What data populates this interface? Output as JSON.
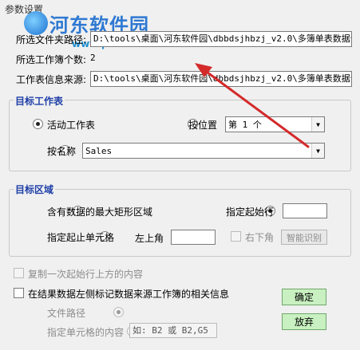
{
  "window": {
    "title": "参数设置"
  },
  "watermark": {
    "brand": "河东软件园",
    "url": "www.pc0359.cn"
  },
  "top": {
    "file_path_label": "所选文件夹路径:",
    "file_path_value": "D:\\tools\\桌面\\河东软件园\\dbbdsjhbzj_v2.0\\多簿单表数据合",
    "workbook_count_label": "所选工作簿个数:",
    "workbook_count_value": "2",
    "sheet_source_label": "工作表信息来源:",
    "sheet_source_value": "D:\\tools\\桌面\\河东软件园\\dbbdsjhbzj_v2.0\\多簿单表数据合"
  },
  "target_sheet": {
    "legend": "目标工作表",
    "active_label": "活动工作表",
    "by_position_label": "按位置",
    "position_value": "第 1 个",
    "by_name_label": "按名称",
    "name_value": "Sales"
  },
  "target_area": {
    "legend": "目标区域",
    "max_rect_label": "含有数据的最大矩形区域",
    "start_row_label": "指定起始行",
    "start_row_value": "",
    "range_label": "指定起止单元格",
    "top_left_label": "左上角",
    "top_left_value": "",
    "bottom_right_label": "右下角",
    "smart_detect_label": "智能识别"
  },
  "options": {
    "copy_header_label": "复制一次起始行上方的内容",
    "mark_source_label": "在结果数据左侧标记数据来源工作簿的相关信息",
    "file_path_option": "文件路径",
    "cell_content_option": "指定单元格的内容",
    "cell_content_value": "如: B2 或 B2,G5"
  },
  "buttons": {
    "ok": "确定",
    "cancel": "放弃"
  },
  "colors": {
    "legend": "#1f3fa8",
    "green_button": "#c8f0c0",
    "annotation_arrow": "#d42a2a"
  }
}
